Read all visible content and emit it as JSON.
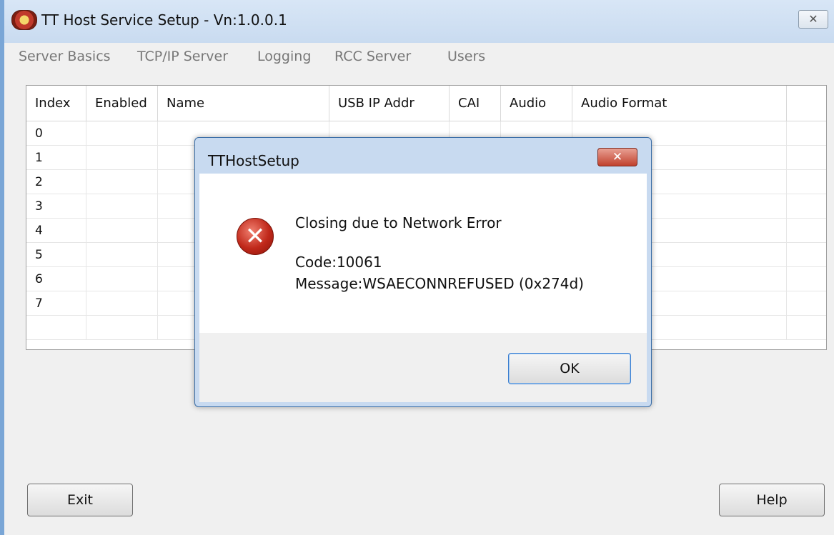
{
  "window": {
    "title": "TT Host Service Setup - Vn:1.0.0.1",
    "close_glyph": "✕"
  },
  "menu": [
    "Server Basics",
    "TCP/IP Server",
    "Logging",
    "RCC Server",
    "Users"
  ],
  "table": {
    "columns": [
      "Index",
      "Enabled",
      "Name",
      "USB IP Addr",
      "CAI",
      "Audio",
      "Audio Format"
    ],
    "rows": [
      "0",
      "1",
      "2",
      "3",
      "4",
      "5",
      "6",
      "7"
    ]
  },
  "buttons": {
    "exit": "Exit",
    "help": "Help"
  },
  "dialog": {
    "title": "TTHostSetup",
    "close_glyph": "✕",
    "message": "Closing due to Network Error",
    "code": "Code:10061",
    "detail": "Message:WSAECONNREFUSED (0x274d)",
    "ok": "OK",
    "icon": "error-icon"
  }
}
